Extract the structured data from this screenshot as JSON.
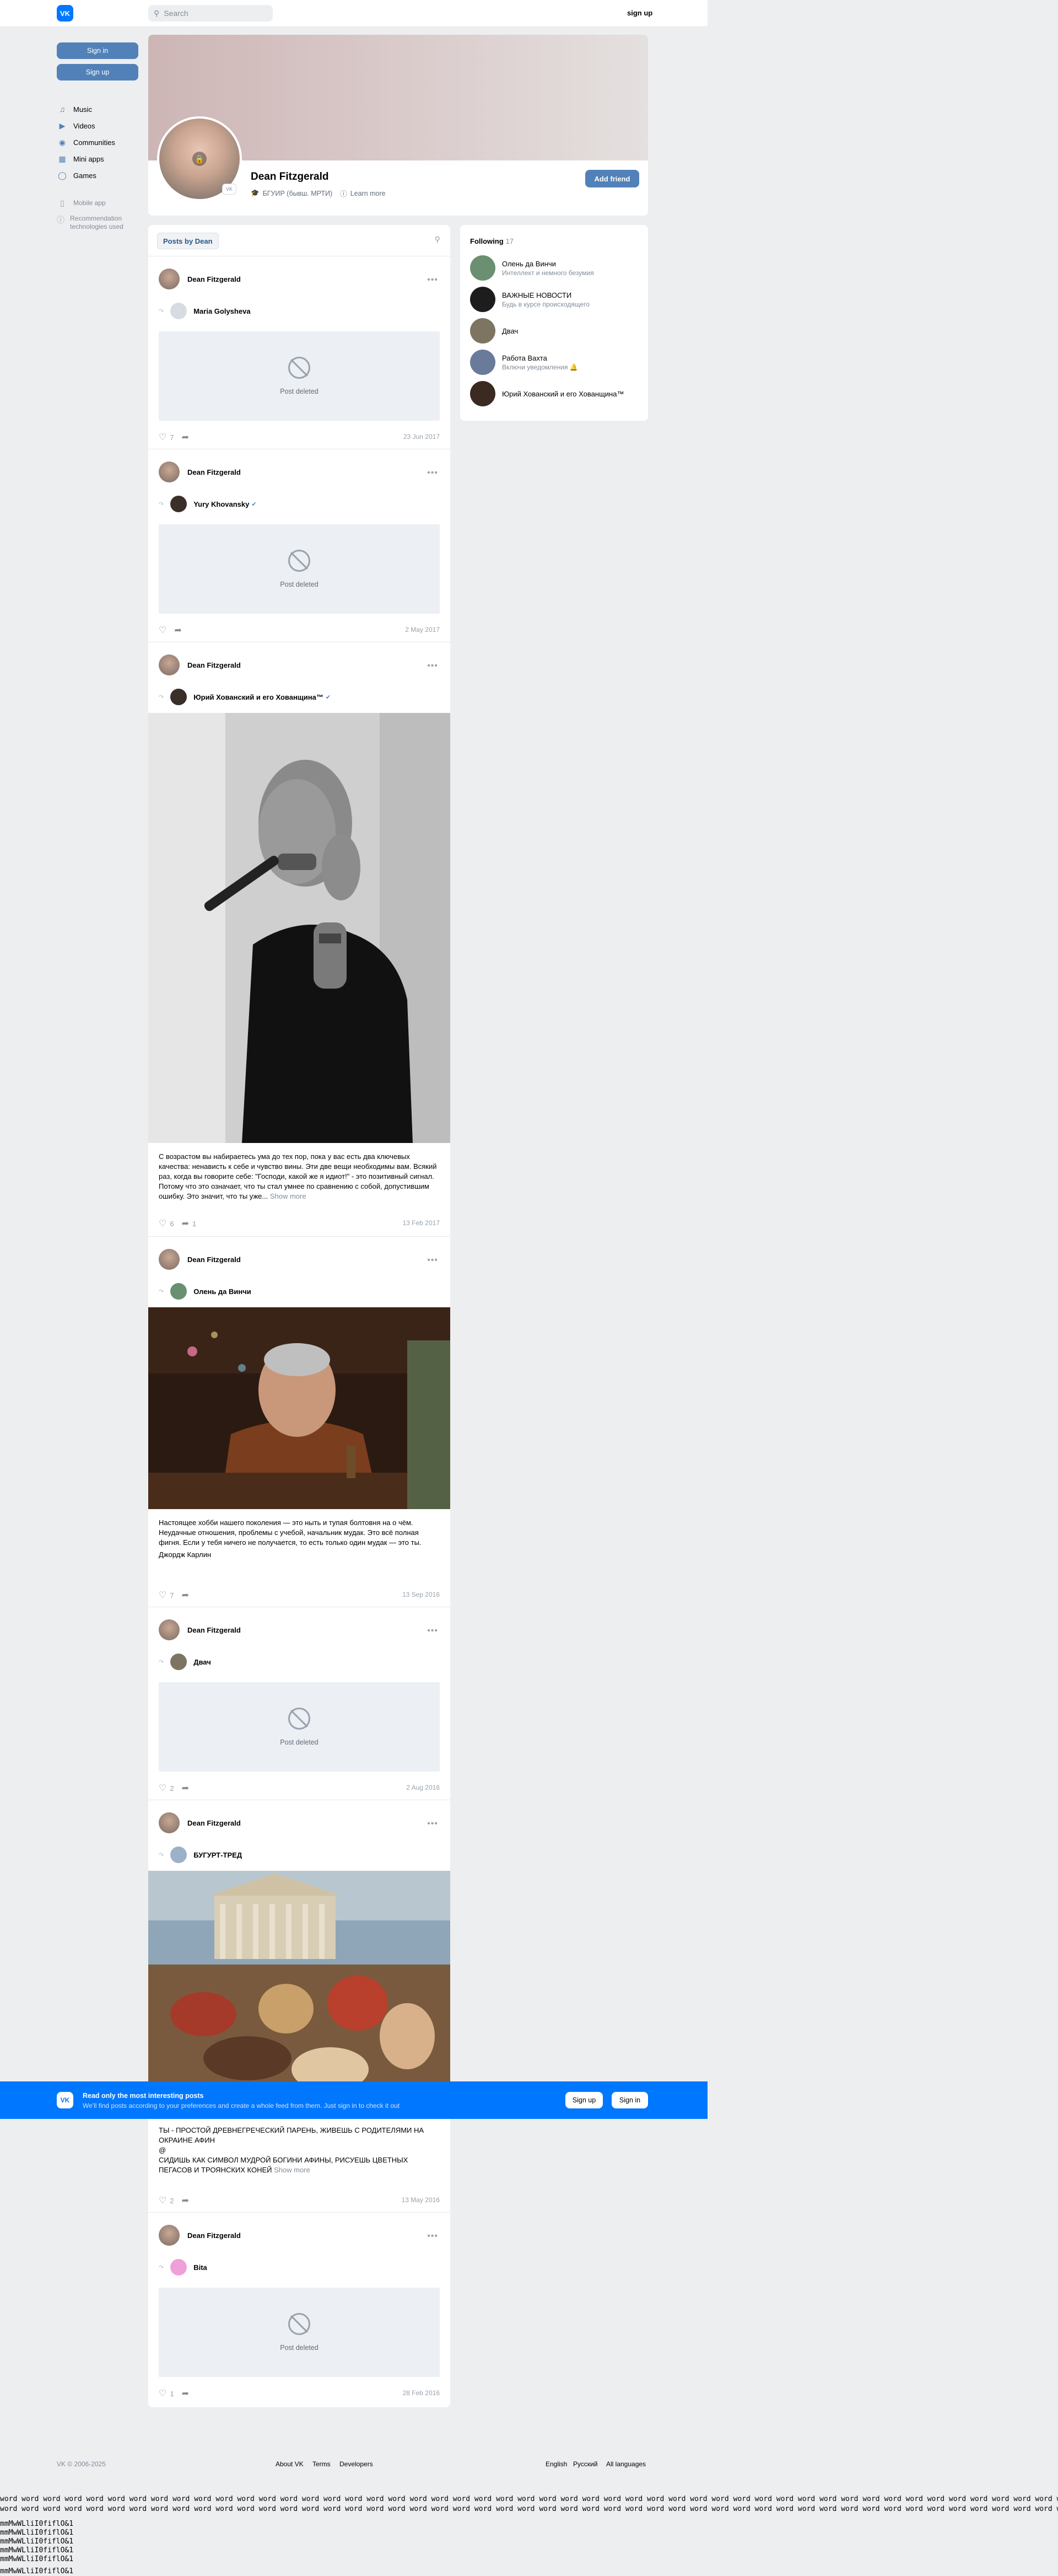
{
  "topbar": {
    "logo": "VK",
    "search_placeholder": "Search",
    "signup": "sign up"
  },
  "sidebar": {
    "signin": "Sign in",
    "signup": "Sign up",
    "menu": [
      {
        "label": "Music",
        "icon": "music-icon"
      },
      {
        "label": "Videos",
        "icon": "video-icon"
      },
      {
        "label": "Communities",
        "icon": "communities-icon"
      },
      {
        "label": "Mini apps",
        "icon": "apps-icon"
      },
      {
        "label": "Games",
        "icon": "games-icon"
      }
    ],
    "mobile_app": "Mobile app",
    "recommendation": "Recommendation technologies used"
  },
  "profile": {
    "name": "Dean Fitzgerald",
    "education": "БГУИР (бывш. МРТИ)",
    "learn_more": "Learn more",
    "add_friend": "Add friend",
    "badge": "VK"
  },
  "wall": {
    "tab": "Posts by Dean",
    "posts": [
      {
        "author": "Dean Fitzgerald",
        "repost_name": "Maria Golysheva",
        "deleted": "Post deleted",
        "likes": "7",
        "date": "23 Jun 2017"
      },
      {
        "author": "Dean Fitzgerald",
        "repost_name": "Yury Khovansky",
        "deleted": "Post deleted",
        "likes": "",
        "date": "2 May 2017"
      },
      {
        "author": "Dean Fitzgerald",
        "repost_name": "Юрий Хованский и его Хованщина™",
        "text": "С возрастом вы набираетесь ума до тех пор, пока у вас есть два ключевых качества: ненависть к себе и чувство вины. Эти две вещи необходимы вам. Всякий раз, когда вы говорите себе: \"Господи, какой же я идиот!\" - это позитивный сигнал. Потому что это означает, что ты стал умнее по сравнению с собой, допустившим ошибку. Это значит, что ты уже...",
        "show_more": "Show more",
        "likes": "6",
        "shares": "1",
        "date": "13 Feb 2017"
      },
      {
        "author": "Dean Fitzgerald",
        "repost_name": "Олень да Винчи",
        "text": "Настоящее хобби нашего поколения — это ныть и тупая болтовня на о чём. Неудачные отношения, проблемы с учебой, начальник мудак. Это всё полная фигня. Если у тебя ничего не получается, то есть только один мудак — это ты.",
        "signature": "Джордж Карлин",
        "likes": "7",
        "date": "13 Sep 2016"
      },
      {
        "author": "Dean Fitzgerald",
        "repost_name": "Двач",
        "deleted": "Post deleted",
        "likes": "2",
        "date": "2 Aug 2016"
      },
      {
        "author": "Dean Fitzgerald",
        "repost_name": "БУГУРТ-ТРЕД",
        "text1": "ТЫ - ПРОСТОЙ ДРЕВНЕГРЕЧЕСКИЙ ПАРЕНЬ, ЖИВЕШЬ С РОДИТЕЛЯМИ НА ОКРАИНЕ АФИН",
        "text2": "@",
        "text3": "СИДИШЬ КАК СИМВОЛ МУДРОЙ БОГИНИ АФИНЫ, РИСУЕШЬ ЦВЕТНЫХ ПЕГАСОВ И ТРОЯНСКИХ КОНЕЙ",
        "show_more": "Show more",
        "likes": "2",
        "date": "13 May 2016"
      },
      {
        "author": "Dean Fitzgerald",
        "repost_name": "Bita",
        "deleted": "Post deleted",
        "likes": "1",
        "date": "28 Feb 2016"
      }
    ]
  },
  "following": {
    "title": "Following",
    "count": "17",
    "items": [
      {
        "name": "Олень да Винчи",
        "sub": "Интеллект и немного безумия",
        "color": "#6b8f71"
      },
      {
        "name": "ВАЖНЫЕ НОВОСТИ",
        "sub": "Будь в курсе происходящего",
        "color": "#1d1d1d"
      },
      {
        "name": "Двач",
        "sub": "",
        "color": "#7d7462"
      },
      {
        "name": "Работа Вахта",
        "sub": "Включи уведомления 🔔",
        "color": "#6a7a9a"
      },
      {
        "name": "Юрий Хованский и его Хованщина™",
        "sub": "",
        "color": "#3a2a22"
      }
    ]
  },
  "banner": {
    "logo": "VK",
    "title": "Read only the most interesting posts",
    "subtitle": "We'll find posts according to your preferences and create a whole feed from them. Just sign in to check it out",
    "signup": "Sign up",
    "signin": "Sign in"
  },
  "footer": {
    "copyright": "VK © 2006-2025",
    "links": [
      "About VK",
      "Terms",
      "Developers"
    ],
    "languages": [
      "English",
      "Русский",
      "All languages"
    ]
  },
  "word_line": "word word word word word word word word word word word word word word word word word word word word word word word word word word word word word word word word word word word word word word word word word word word word word word word word word word word word word word word word word word word word word word word word word word word word word word word word word word word word word word word word word word word word word word word word word word word word word word word word word word word word word word word word word word word word word word word word word",
  "measures": [
    "mmMwWLliI0fiflO&1",
    "mmMwWLliI0fiflO&1",
    "mmMwWLliI0fiflO&1",
    "mmMwWLliI0fiflO&1",
    "mmMwWLliI0fiflO&1",
    "mmMwWLliI0fiflO&1"
  ]
}
